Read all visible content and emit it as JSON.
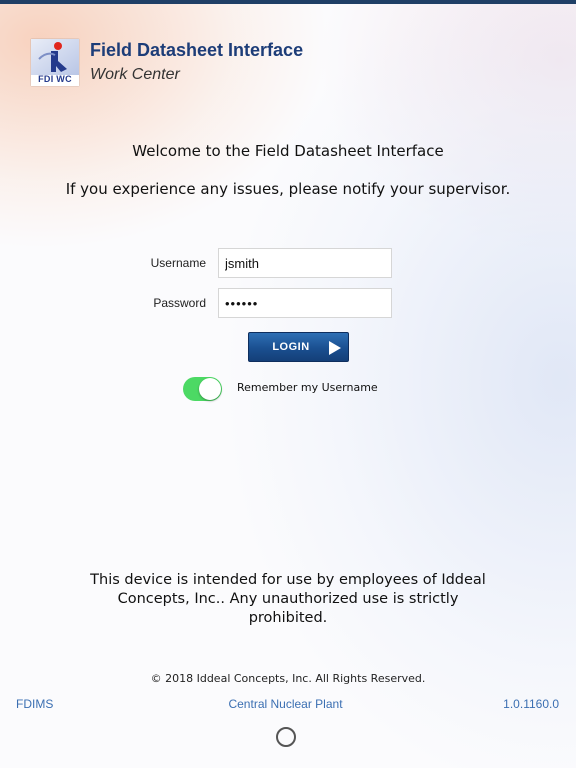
{
  "header": {
    "logo_text": "FDI WC",
    "title": "Field Datasheet Interface",
    "subtitle": "Work Center"
  },
  "messages": {
    "welcome": "Welcome to the Field Datasheet Interface",
    "notice": "If you experience any issues, please notify your supervisor."
  },
  "form": {
    "username_label": "Username",
    "username_value": "jsmith",
    "password_label": "Password",
    "password_value": "••••••",
    "login_label": "LOGIN",
    "remember_label": "Remember my Username",
    "remember_on": true
  },
  "disclaimer": "This device is intended for use by employees of Iddeal Concepts, Inc..  Any unauthorized use is strictly prohibited.",
  "footer": {
    "copyright": "© 2018 Iddeal Concepts, Inc.   All Rights Reserved.",
    "left": "FDIMS",
    "center": "Central Nuclear Plant",
    "right": "1.0.1160.0"
  },
  "colors": {
    "brand_blue": "#1d3d78",
    "link_blue": "#3b6fb2",
    "toggle_on": "#4cd964",
    "button_blue": "#1a4f90"
  },
  "icons": {
    "login_button": "play-icon",
    "logo": "fdiwc-logo"
  }
}
